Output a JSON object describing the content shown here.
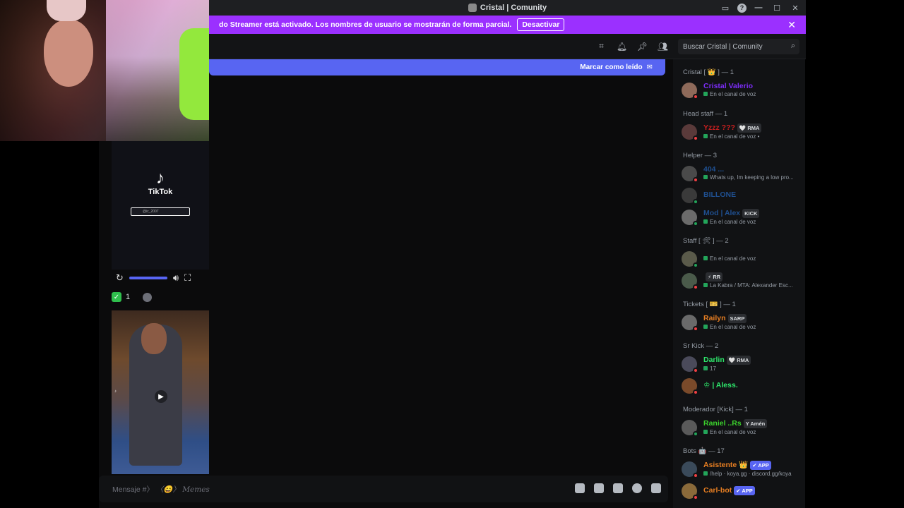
{
  "window": {
    "title": "Cristal | Comunity"
  },
  "banner": {
    "text": "do Streamer está activado. Los nombres de usuario se mostrarán de forma parcial.",
    "button": "Desactivar"
  },
  "header": {
    "search_placeholder": "Buscar Cristal | Comunity"
  },
  "chat": {
    "new_messages_action": "Marcar como leído",
    "composer_placeholder": "Mensaje #〉",
    "composer_channel": "〈😄〉 Memes"
  },
  "tiktok": {
    "brand": "TikTok",
    "search_text": "@ic_2007"
  },
  "reactions": {
    "check_count": "1"
  },
  "members": {
    "groups": [
      {
        "role": "Cristal [ 👑 ] — 1",
        "members": [
          {
            "name": "Cristal Valerio",
            "color": "#7b2cf5",
            "status": "En el canal de voz",
            "tag": "",
            "online": false
          }
        ]
      },
      {
        "role": "Head staff — 1",
        "members": [
          {
            "name": "Yzzz ???",
            "color": "#c51f1f",
            "status": "En el canal de voz •",
            "tag": "🤍 RMA",
            "online": false
          }
        ]
      },
      {
        "role": "Helper — 3",
        "members": [
          {
            "name": "404 ...",
            "color": "#1f4f8f",
            "status": "Whats up, Im keeping a low pro...",
            "tag": "",
            "online": false
          },
          {
            "name": "BILLONE",
            "color": "#1f4f8f",
            "status": "",
            "tag": "",
            "online": true
          },
          {
            "name": "Mod | Alex",
            "color": "#1f4f8f",
            "status": "En el canal de voz",
            "tag": "KICK",
            "online": true
          }
        ]
      },
      {
        "role": "Staff [ 🛠 ] — 2",
        "members": [
          {
            "name": "",
            "color": "#dbdee1",
            "status": "En el canal de voz",
            "tag": "",
            "online": true
          },
          {
            "name": "",
            "color": "#dbdee1",
            "status": "La Kabra / MTA: Alexander Esc...",
            "tag": "⚡ RR",
            "online": false
          }
        ]
      },
      {
        "role": "Tickets [ 🎫 ] — 1",
        "members": [
          {
            "name": "Railyn",
            "color": "#e67e22",
            "status": "En el canal de voz",
            "tag": "SARP",
            "online": false
          }
        ]
      },
      {
        "role": "Sr Kick — 2",
        "members": [
          {
            "name": "Darlin",
            "color": "#2ee66b",
            "status": "17",
            "tag": "🤍 RMA",
            "online": false
          },
          {
            "name": "♔ | Aless.",
            "color": "#2ee66b",
            "status": "",
            "tag": "",
            "online": false
          }
        ]
      },
      {
        "role": "Moderador [Kick] — 1",
        "members": [
          {
            "name": "Raniel ..Rs",
            "color": "#3bd12c",
            "status": "En el canal de voz",
            "tag": "Y Amén",
            "online": true
          }
        ]
      },
      {
        "role": "Bots 🤖 — 17",
        "members": [
          {
            "name": "Asistente 👑",
            "color": "#e67e22",
            "status": "/help · koya.gg · discord.gg/koya",
            "tag": "✔ APP",
            "online": false
          },
          {
            "name": "Carl-bot",
            "color": "#e67e22",
            "status": "",
            "tag": "✔ APP",
            "online": false
          }
        ]
      }
    ]
  },
  "colors": {
    "accent": "#5865f2",
    "banner": "#9b30ff",
    "background": "#0b0b0c"
  }
}
